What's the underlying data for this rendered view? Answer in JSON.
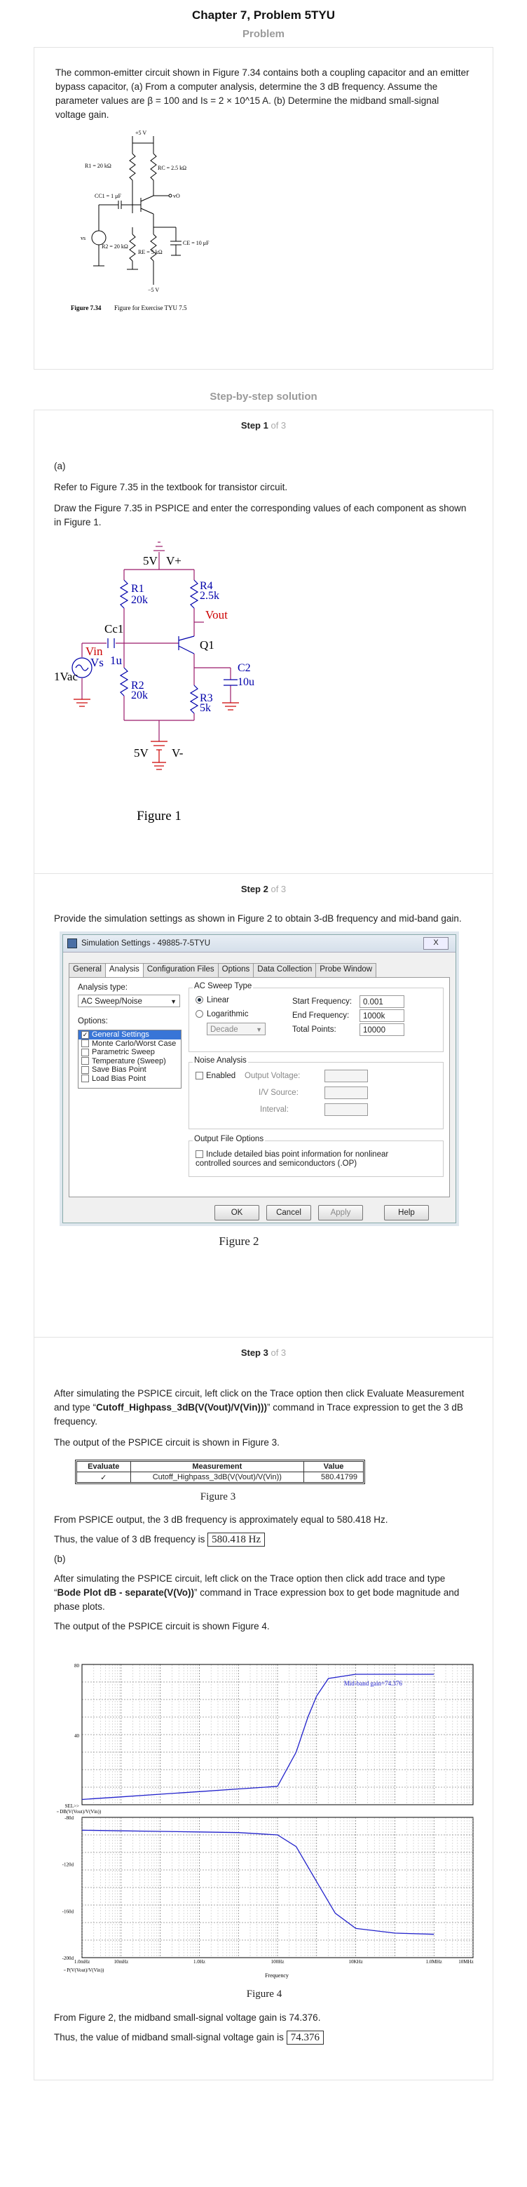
{
  "page": {
    "title": "Chapter 7, Problem 5TYU",
    "problem_label": "Problem",
    "solution_label": "Step-by-step solution"
  },
  "problem": {
    "text": "The common-emitter circuit shown in Figure 7.34 contains both a coupling capacitor and an emitter bypass capacitor, (a) From a computer analysis, determine the 3 dB frequency. Assume the parameter values are β = 100 and Is = 2 × 10^15 A. (b) Determine the midband small-signal voltage gain.",
    "fig_labels": {
      "vplus": "+5 V",
      "r1": "R1 = 20 kΩ",
      "rc": "RC = 2.5 kΩ",
      "cc1": "CC1 = 1 μF",
      "vo": "vO",
      "vs": "vs",
      "r2": "R2 = 20 kΩ",
      "re": "RE = 5 kΩ",
      "ce": "CE = 10 μF",
      "vminus": "−5 V"
    },
    "figure_caption_num": "Figure 7.34",
    "figure_caption_text": "Figure for Exercise TYU 7.5"
  },
  "steps": [
    {
      "title": "Step 1",
      "of": "of 3",
      "part": "(a)",
      "paras": [
        "Refer to Figure 7.35 in the textbook for transistor circuit.",
        "Draw the Figure 7.35 in PSPICE and enter the corresponding values of each component as shown in Figure 1."
      ],
      "figure": {
        "v5": "5V",
        "vplus": "V+",
        "r1": "R1",
        "r1v": "20k",
        "r4": "R4",
        "r4v": "2.5k",
        "vout": "Vout",
        "cc1": "Cc1",
        "cc1v": "1u",
        "q1": "Q1",
        "vin": "Vin",
        "vs": "Vs",
        "vac": "1Vac",
        "c2": "C2",
        "c2v": "10u",
        "r2": "R2",
        "r2v": "20k",
        "r3": "R3",
        "r3v": "5k",
        "v5b": "5V",
        "vminus": "V-",
        "caption": "Figure 1"
      }
    },
    {
      "title": "Step 2",
      "of": "of 3",
      "paras": [
        "Provide the simulation settings as shown in Figure 2 to obtain 3-dB frequency and mid-band gain."
      ],
      "dialog": {
        "title": "Simulation Settings - 49885-7-5TYU",
        "close": "X",
        "tabs": [
          "General",
          "Analysis",
          "Configuration Files",
          "Options",
          "Data Collection",
          "Probe Window"
        ],
        "analysis_type_label": "Analysis type:",
        "analysis_type": "AC Sweep/Noise",
        "options_label": "Options:",
        "options": [
          "General Settings",
          "Monte Carlo/Worst Case",
          "Parametric Sweep",
          "Temperature (Sweep)",
          "Save Bias Point",
          "Load Bias Point"
        ],
        "sweep_type_label": "AC Sweep Type",
        "linear": "Linear",
        "logarithmic": "Logarithmic",
        "decade": "Decade",
        "start_label": "Start Frequency:",
        "start": "0.001",
        "end_label": "End Frequency:",
        "end": "1000k",
        "points_label": "Total Points:",
        "points": "10000",
        "noise_label": "Noise Analysis",
        "enabled": "Enabled",
        "output_voltage": "Output Voltage:",
        "iv_source": "I/V Source:",
        "interval": "Interval:",
        "output_file_label": "Output File Options",
        "include_text": "Include detailed bias point information for nonlinear controlled sources and semiconductors (.OP)",
        "ok": "OK",
        "cancel": "Cancel",
        "apply": "Apply",
        "help": "Help"
      },
      "caption": "Figure 2"
    },
    {
      "title": "Step 3",
      "of": "of 3",
      "para1_a": "After simulating the PSPICE circuit, left click on the Trace option then click Evaluate Measurement and type “",
      "para1_bold": "Cutoff_Highpass_3dB(V(Vout)/V(Vin)))",
      "para1_b": "” command in Trace expression to get the 3 dB frequency.",
      "para2": "The output of the PSPICE circuit is shown in Figure 3.",
      "table": {
        "headers": [
          "Evaluate",
          "Measurement",
          "Value"
        ],
        "row": [
          "✓",
          "Cutoff_Highpass_3dB(V(Vout)/V(Vin))",
          "580.41799"
        ]
      },
      "caption3": "Figure 3",
      "para3": "From PSPICE output, the 3 dB frequency is approximately equal to 580.418 Hz.",
      "para4": "Thus, the value of 3 dB frequency is",
      "answer_a": "580.418 Hz",
      "part_b": "(b)",
      "para5_a": "After simulating the PSPICE circuit, left click on the Trace option then click add trace and type “",
      "para5_bold": "Bode Plot dB - separate(V(Vo))",
      "para5_b": "” command in Trace expression box to get bode magnitude and phase plots.",
      "para6": "The output of the PSPICE circuit is shown Figure 4.",
      "caption4": "Figure 4",
      "para7": "From Figure 2, the midband small-signal voltage gain is 74.376.",
      "para8": "Thus, the value of midband small-signal voltage gain is",
      "answer_b": "74.376"
    }
  ],
  "chart_data": [
    {
      "type": "line",
      "x_scale": "log",
      "x_ticks": [
        "1.0mHz",
        "10mHz",
        "1.0Hz",
        "100Hz",
        "10KHz",
        "1.0MHz",
        "10MHz"
      ],
      "y_ticks": [
        "80",
        "40",
        "SEL>>"
      ],
      "ylim": [
        0,
        80
      ],
      "annotation": "Mid-band gain=74.376",
      "legend": "DB(V(Vout)/V(Vin))",
      "series": [
        {
          "x": [
            0.001,
            0.01,
            0.1,
            1,
            10,
            100,
            300,
            600,
            1000,
            2000,
            10000,
            100000,
            1000000
          ],
          "y": [
            3,
            4.5,
            6,
            7.5,
            9,
            10.5,
            30,
            50,
            62,
            72,
            74.4,
            74.4,
            74.4
          ]
        }
      ]
    },
    {
      "type": "line",
      "x_scale": "log",
      "y_ticks": [
        "-80d",
        "-120d",
        "-160d",
        "-200d"
      ],
      "ylim": [
        -200,
        -80
      ],
      "legend": "P(V(Vout)/V(Vin))",
      "xlabel": "Frequency",
      "series": [
        {
          "x": [
            0.001,
            0.01,
            0.1,
            1,
            10,
            100,
            300,
            1000,
            3000,
            10000,
            100000,
            1000000
          ],
          "y": [
            -91,
            -91.5,
            -92,
            -92.5,
            -93,
            -95,
            -105,
            -135,
            -162,
            -175,
            -179,
            -180
          ]
        }
      ]
    }
  ]
}
